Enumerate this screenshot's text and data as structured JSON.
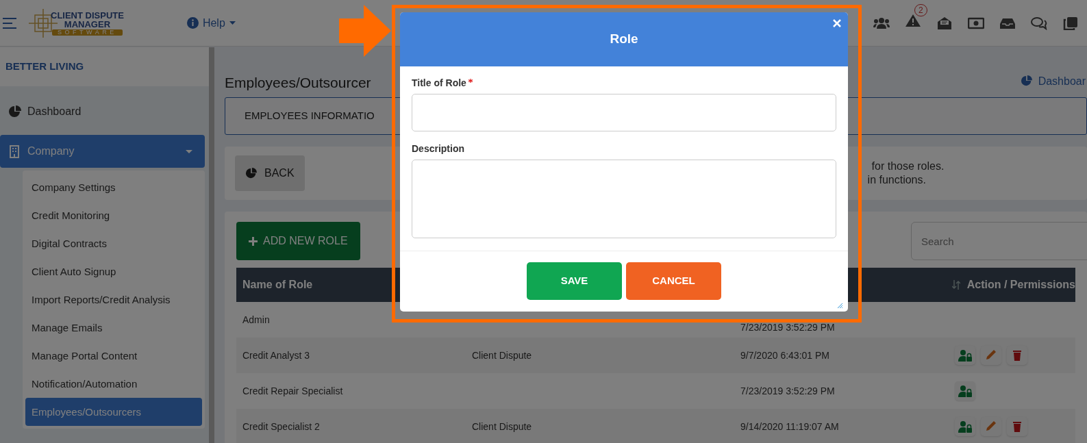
{
  "header": {
    "company_logo": {
      "line_1": "CLIENT DISPUTE",
      "line_2": "MANAGER",
      "line_3": "SOFTWARE"
    },
    "help": "Help",
    "alert_badge": "2"
  },
  "sidebar": {
    "account": "BETTER LIVING",
    "items": [
      {
        "label": "Dashboard",
        "kind": "chart",
        "expanded": false
      },
      {
        "label": "Company",
        "kind": "building",
        "expanded": true
      }
    ],
    "submenu": [
      {
        "label": "Company Settings",
        "selected": false
      },
      {
        "label": "Credit Monitoring",
        "selected": false
      },
      {
        "label": "Digital Contracts",
        "selected": false
      },
      {
        "label": "Client Auto Signup",
        "selected": false
      },
      {
        "label": "Import Reports/Credit Analysis",
        "selected": false
      },
      {
        "label": "Manage Emails",
        "selected": false
      },
      {
        "label": "Manage Portal Content",
        "selected": false
      },
      {
        "label": "Notification/Automation",
        "selected": false
      },
      {
        "label": "Employees/Outsourcers",
        "selected": true
      }
    ]
  },
  "page": {
    "title": "Employees/Outsourcer",
    "dashboard_link": "Dashboar",
    "tab": "EMPLOYEES INFORMATIO",
    "back": "BACK",
    "info_lines": [
      "for those roles.",
      "in functions."
    ],
    "add_button": "ADD NEW ROLE",
    "search": {
      "placeholder": "Search"
    }
  },
  "table": {
    "columns": [
      "Name of Role",
      "Action / Permissions"
    ],
    "rows": [
      {
        "name": "Admin",
        "type": "",
        "date": "7/23/2019 3:52:29 PM",
        "permissions": false,
        "edit": false,
        "delete": false
      },
      {
        "name": "Credit Analyst 3",
        "type": "Client Dispute",
        "date": "9/7/2020 6:43:01 PM",
        "permissions": true,
        "edit": true,
        "delete": true
      },
      {
        "name": "Credit Repair Specialist",
        "type": "",
        "date": "7/23/2019 3:52:29 PM",
        "permissions": true,
        "edit": false,
        "delete": false
      },
      {
        "name": "Credit Specialist 2",
        "type": "Client Dispute",
        "date": "9/14/2020 11:19:07 AM",
        "permissions": true,
        "edit": true,
        "delete": true
      }
    ]
  },
  "dialog": {
    "title": "Role",
    "fields": [
      {
        "label": "Title of Role",
        "required": true,
        "kind": "input"
      },
      {
        "label": "Description",
        "required": false,
        "kind": "textarea"
      }
    ],
    "buttons": [
      {
        "label": "SAVE",
        "kind": "primary"
      },
      {
        "label": "CANCEL",
        "kind": "secondary"
      }
    ]
  }
}
